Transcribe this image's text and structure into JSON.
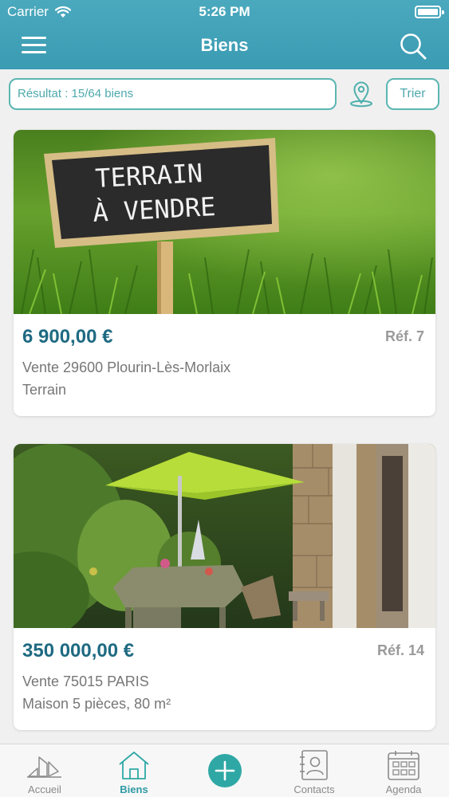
{
  "status_bar": {
    "carrier": "Carrier",
    "time": "5:26 PM"
  },
  "nav": {
    "title": "Biens"
  },
  "filter": {
    "result_text": "Résultat : 15/64 biens",
    "sort_label": "Trier"
  },
  "listings": [
    {
      "price": "6 900,00 €",
      "ref": "Réf. 7",
      "line1": "Vente 29600 Plourin-Lès-Morlaix",
      "line2": "Terrain",
      "sign_line1": "TERRAIN",
      "sign_line2": "À VENDRE"
    },
    {
      "price": "350 000,00 €",
      "ref": "Réf. 14",
      "line1": "Vente 75015 PARIS",
      "line2": "Maison 5 pièces, 80 m²"
    }
  ],
  "tabs": [
    {
      "label": "Accueil",
      "icon": "bar-chart-icon",
      "active": false
    },
    {
      "label": "Biens",
      "icon": "house-icon",
      "active": true
    },
    {
      "label": "",
      "icon": "add-icon",
      "active": false
    },
    {
      "label": "Contacts",
      "icon": "contact-card-icon",
      "active": false
    },
    {
      "label": "Agenda",
      "icon": "calendar-icon",
      "active": false
    }
  ],
  "colors": {
    "header": "#3fa1b7",
    "accent": "#5bb6b2",
    "price": "#1e6a82",
    "active_tab": "#2f9aa4"
  }
}
